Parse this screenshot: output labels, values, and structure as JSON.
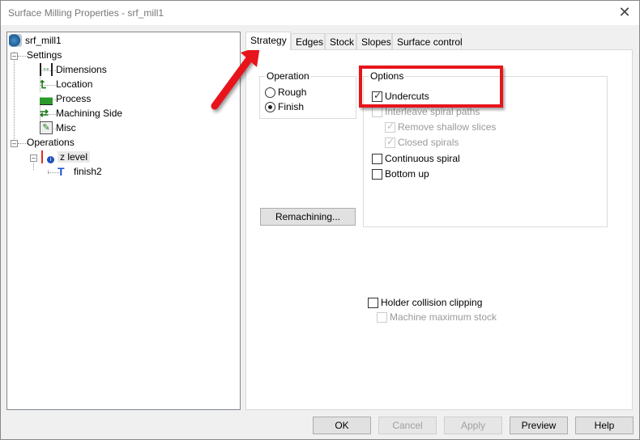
{
  "window": {
    "title": "Surface Milling Properties - srf_mill1",
    "close_icon": "close-icon"
  },
  "tree": {
    "root": "srf_mill1",
    "settings": {
      "label": "Settings",
      "items": [
        "Dimensions",
        "Location",
        "Process",
        "Machining Side",
        "Misc"
      ]
    },
    "operations": {
      "label": "Operations",
      "item": "z level",
      "child": "finish2"
    }
  },
  "tabs": [
    "Strategy",
    "Edges",
    "Stock",
    "Slopes",
    "Surface control"
  ],
  "strategy": {
    "operation": {
      "label": "Operation",
      "rough": "Rough",
      "finish": "Finish",
      "selected": "Finish"
    },
    "remachining": "Remachining...",
    "options": {
      "label": "Options",
      "undercuts": "Undercuts",
      "interleave": "Interleave spiral paths",
      "remove_shallow": "Remove shallow slices",
      "closed_spirals": "Closed spirals",
      "continuous_spiral": "Continuous spiral",
      "bottom_up": "Bottom up"
    },
    "holder_clipping": "Holder collision clipping",
    "machine_max_stock": "Machine maximum stock"
  },
  "buttons": {
    "ok": "OK",
    "cancel": "Cancel",
    "apply": "Apply",
    "preview": "Preview",
    "help": "Help"
  },
  "annotation": {
    "color": "#e8141b"
  }
}
